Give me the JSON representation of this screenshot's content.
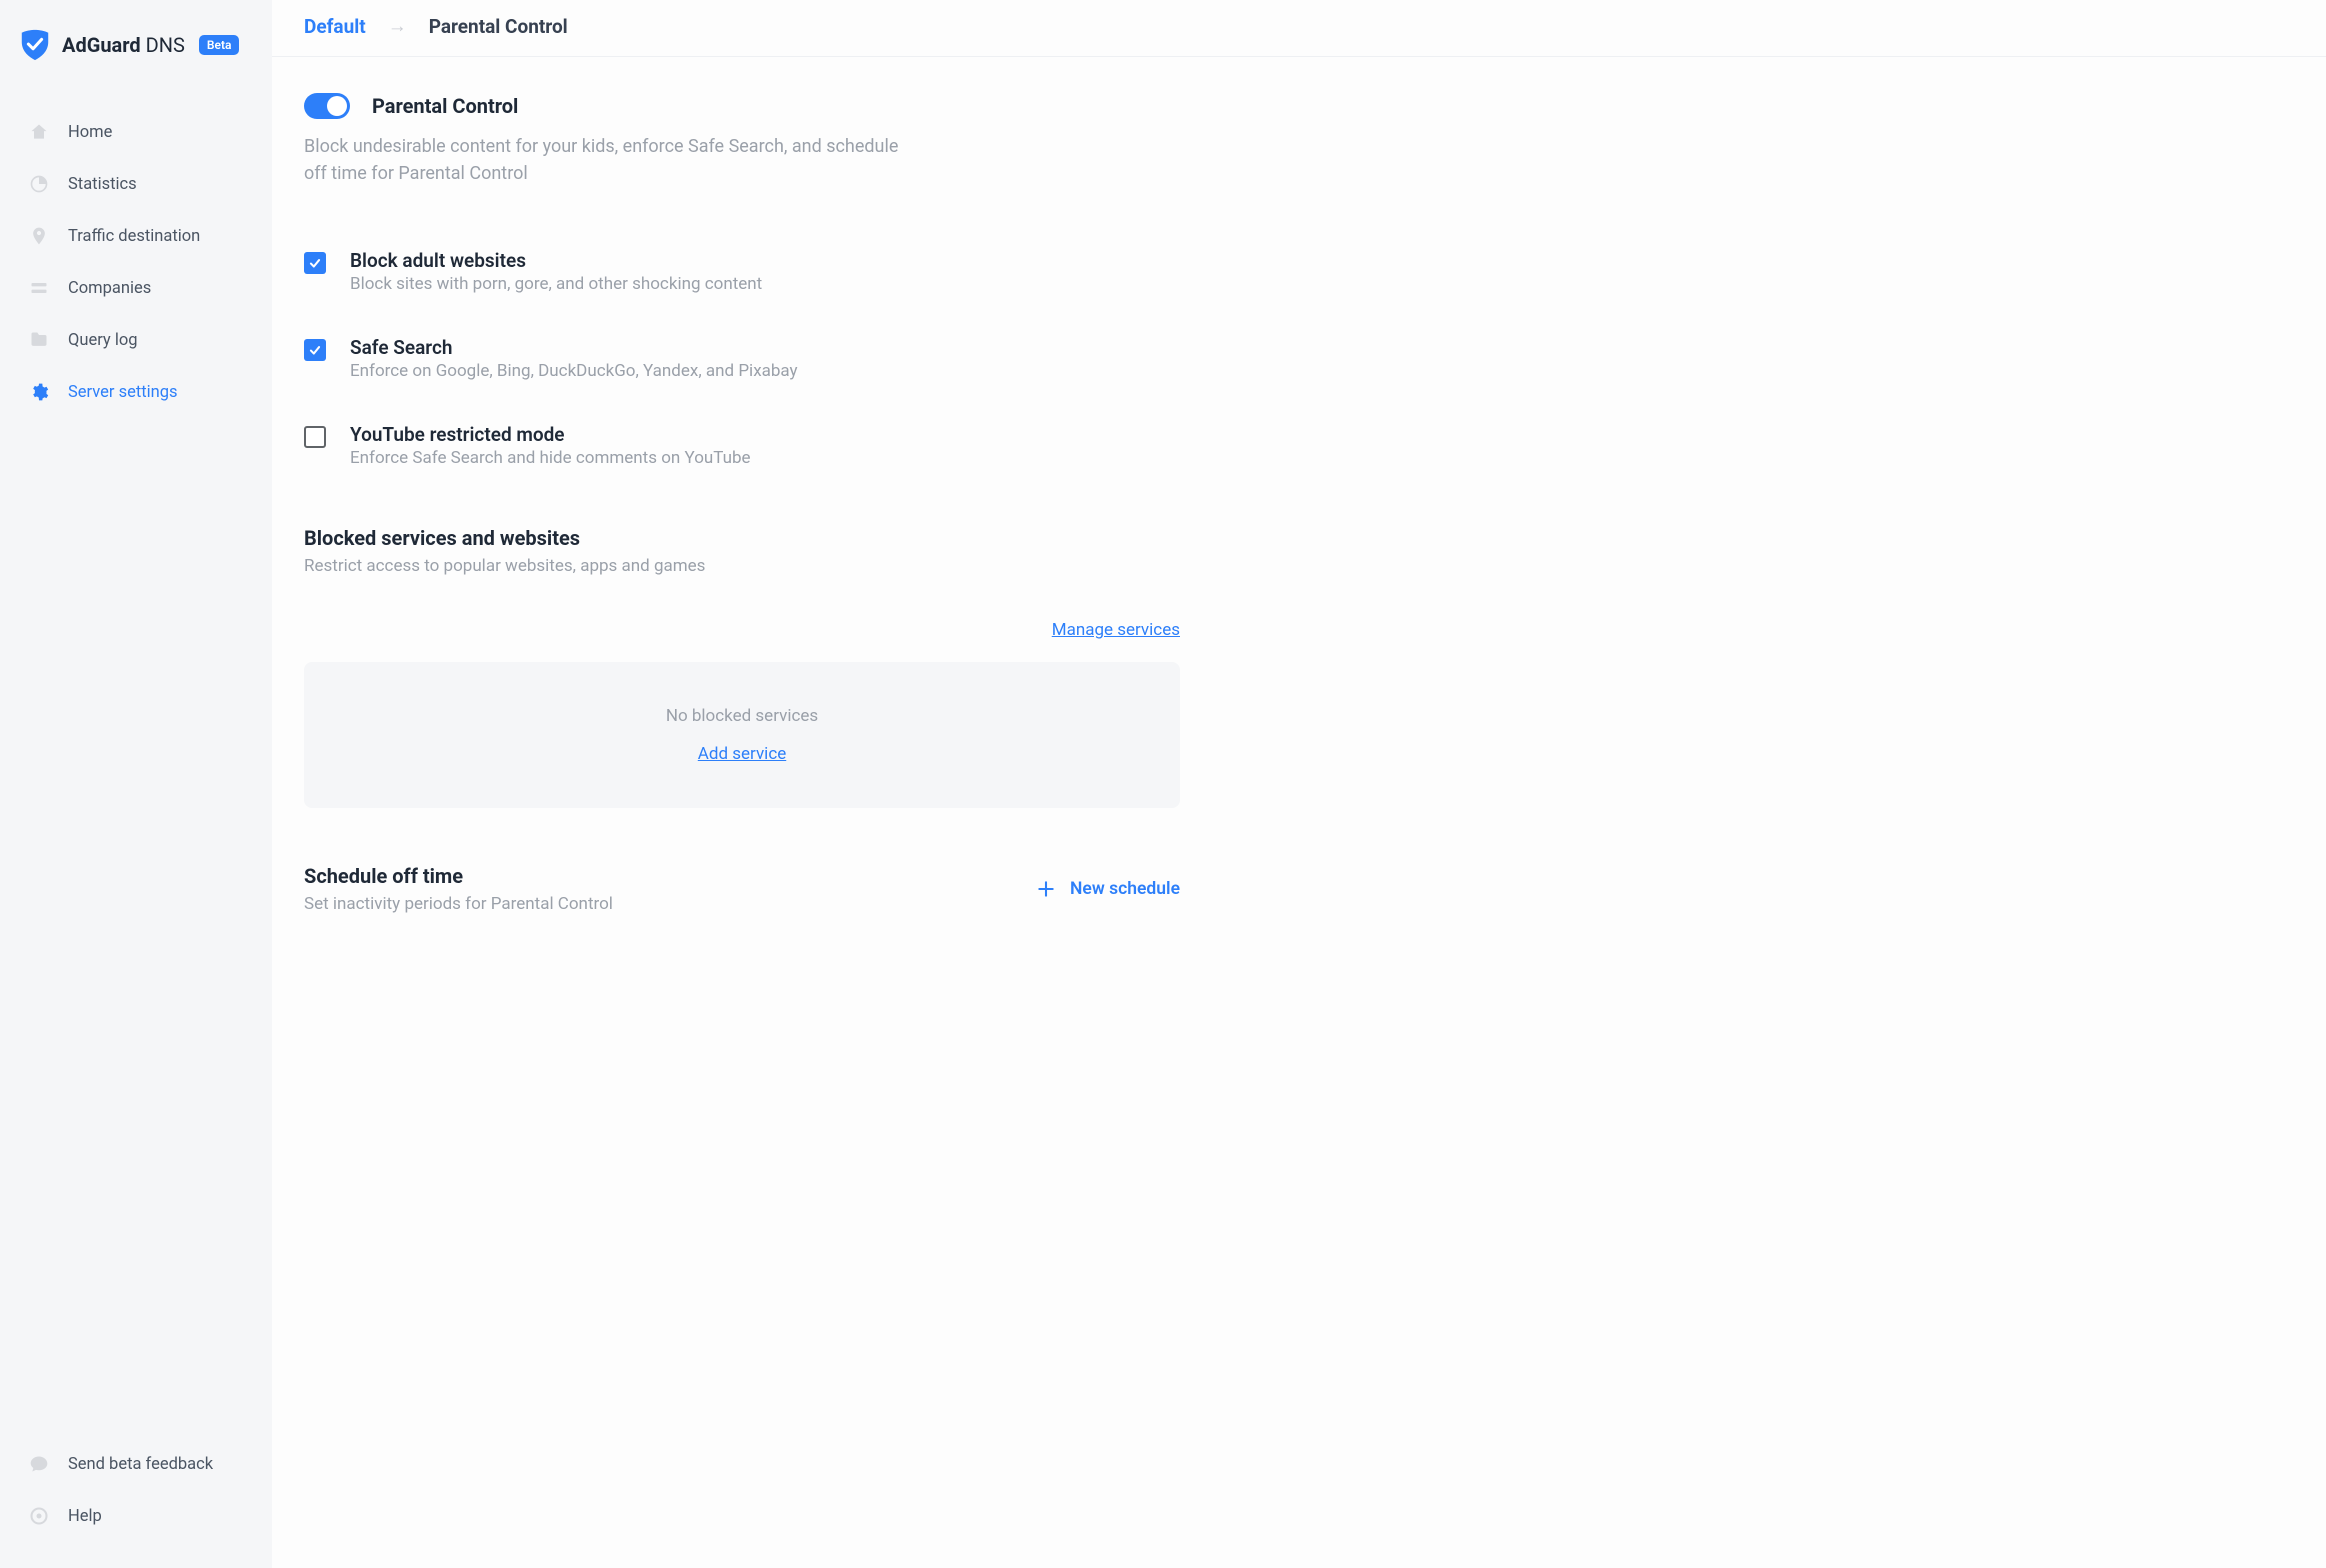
{
  "brand": {
    "name_strong": "AdGuard",
    "name_light": "DNS",
    "badge": "Beta"
  },
  "sidebar": {
    "items": [
      {
        "label": "Home"
      },
      {
        "label": "Statistics"
      },
      {
        "label": "Traffic destination"
      },
      {
        "label": "Companies"
      },
      {
        "label": "Query log"
      },
      {
        "label": "Server settings"
      }
    ],
    "bottom": [
      {
        "label": "Send beta feedback"
      },
      {
        "label": "Help"
      }
    ]
  },
  "breadcrumb": {
    "root": "Default",
    "current": "Parental Control"
  },
  "main": {
    "title": "Parental Control",
    "subtitle": "Block undesirable content for your kids, enforce Safe Search, and schedule off time for Parental Control"
  },
  "options": [
    {
      "title": "Block adult websites",
      "desc": "Block sites with porn, gore, and other shocking content",
      "checked": true
    },
    {
      "title": "Safe Search",
      "desc": "Enforce on Google, Bing, DuckDuckGo, Yandex, and Pixabay",
      "checked": true
    },
    {
      "title": "YouTube restricted mode",
      "desc": "Enforce Safe Search and hide comments on YouTube",
      "checked": false
    }
  ],
  "blocked_services": {
    "title": "Blocked services and websites",
    "subtitle": "Restrict access to popular websites, apps and games",
    "manage_link": "Manage services",
    "empty_text": "No blocked services",
    "add_link": "Add service"
  },
  "schedule": {
    "title": "Schedule off time",
    "subtitle": "Set inactivity periods for Parental Control",
    "new_button": "New schedule"
  }
}
